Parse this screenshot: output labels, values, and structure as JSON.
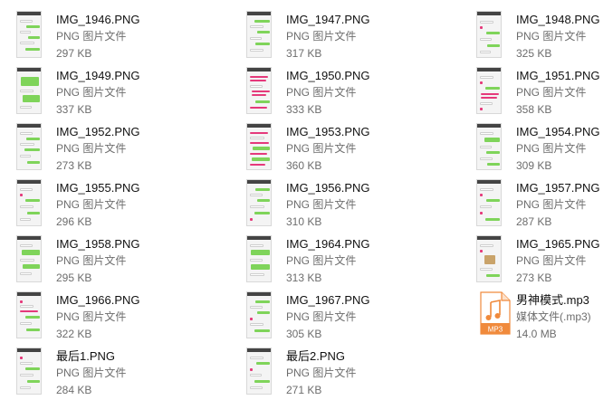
{
  "files": [
    {
      "name": "IMG_1946.PNG",
      "type": "PNG 图片文件",
      "size": "297 KB",
      "icon": "image-thumbnail"
    },
    {
      "name": "IMG_1947.PNG",
      "type": "PNG 图片文件",
      "size": "317 KB",
      "icon": "image-thumbnail"
    },
    {
      "name": "IMG_1948.PNG",
      "type": "PNG 图片文件",
      "size": "325 KB",
      "icon": "image-thumbnail"
    },
    {
      "name": "IMG_1949.PNG",
      "type": "PNG 图片文件",
      "size": "337 KB",
      "icon": "image-thumbnail"
    },
    {
      "name": "IMG_1950.PNG",
      "type": "PNG 图片文件",
      "size": "333 KB",
      "icon": "image-thumbnail"
    },
    {
      "name": "IMG_1951.PNG",
      "type": "PNG 图片文件",
      "size": "358 KB",
      "icon": "image-thumbnail"
    },
    {
      "name": "IMG_1952.PNG",
      "type": "PNG 图片文件",
      "size": "273 KB",
      "icon": "image-thumbnail"
    },
    {
      "name": "IMG_1953.PNG",
      "type": "PNG 图片文件",
      "size": "360 KB",
      "icon": "image-thumbnail"
    },
    {
      "name": "IMG_1954.PNG",
      "type": "PNG 图片文件",
      "size": "309 KB",
      "icon": "image-thumbnail"
    },
    {
      "name": "IMG_1955.PNG",
      "type": "PNG 图片文件",
      "size": "296 KB",
      "icon": "image-thumbnail"
    },
    {
      "name": "IMG_1956.PNG",
      "type": "PNG 图片文件",
      "size": "310 KB",
      "icon": "image-thumbnail"
    },
    {
      "name": "IMG_1957.PNG",
      "type": "PNG 图片文件",
      "size": "287 KB",
      "icon": "image-thumbnail"
    },
    {
      "name": "IMG_1958.PNG",
      "type": "PNG 图片文件",
      "size": "295 KB",
      "icon": "image-thumbnail"
    },
    {
      "name": "IMG_1964.PNG",
      "type": "PNG 图片文件",
      "size": "313 KB",
      "icon": "image-thumbnail"
    },
    {
      "name": "IMG_1965.PNG",
      "type": "PNG 图片文件",
      "size": "273 KB",
      "icon": "image-thumbnail"
    },
    {
      "name": "IMG_1966.PNG",
      "type": "PNG 图片文件",
      "size": "322 KB",
      "icon": "image-thumbnail"
    },
    {
      "name": "IMG_1967.PNG",
      "type": "PNG 图片文件",
      "size": "305 KB",
      "icon": "image-thumbnail"
    },
    {
      "name": "男神模式.mp3",
      "type": "媒体文件(.mp3)",
      "size": "14.0 MB",
      "icon": "mp3-file-icon"
    },
    {
      "name": "最后1.PNG",
      "type": "PNG 图片文件",
      "size": "284 KB",
      "icon": "image-thumbnail"
    },
    {
      "name": "最后2.PNG",
      "type": "PNG 图片文件",
      "size": "271 KB",
      "icon": "image-thumbnail"
    }
  ],
  "mp3_badge": "MP3",
  "colors": {
    "mp3_orange": "#f08a3c",
    "chat_green": "#7fd45a",
    "chat_pink": "#e5397b"
  }
}
